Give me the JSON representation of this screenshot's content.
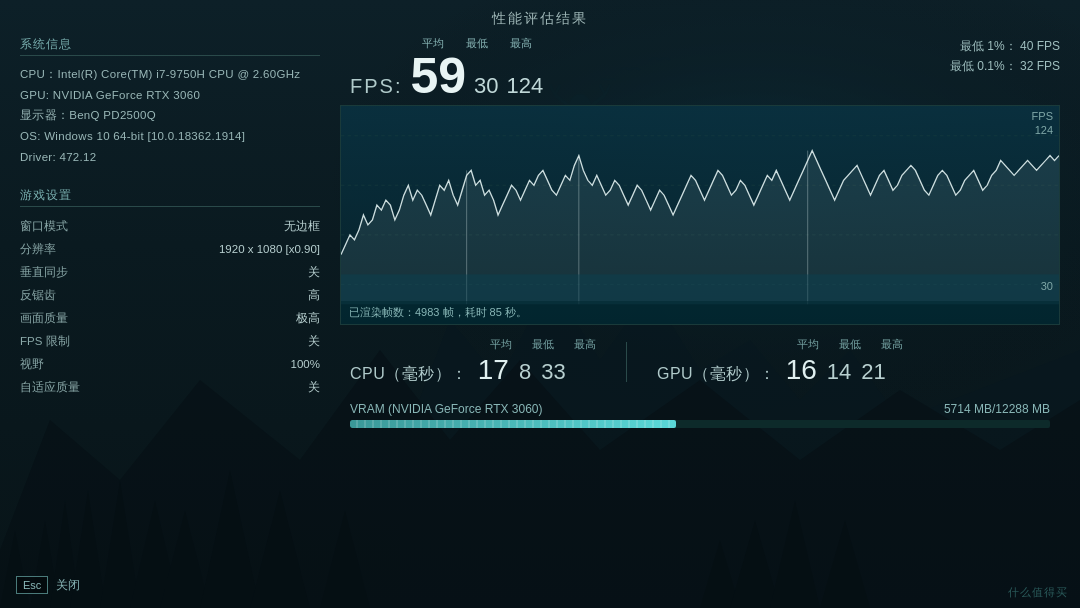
{
  "title": "性能评估结果",
  "left": {
    "system_title": "系统信息",
    "system_info": [
      "CPU：Intel(R) Core(TM) i7-9750H CPU @ 2.60GHz",
      "GPU: NVIDIA GeForce RTX 3060",
      "显示器：BenQ PD2500Q",
      "OS: Windows 10  64-bit [10.0.18362.1914]",
      "Driver: 472.12"
    ],
    "settings_title": "游戏设置",
    "settings": [
      {
        "key": "窗口模式",
        "val": "无边框"
      },
      {
        "key": "分辨率",
        "val": "1920 x 1080 [x0.90]"
      },
      {
        "key": "垂直同步",
        "val": "关"
      },
      {
        "key": "反锯齿",
        "val": "高"
      },
      {
        "key": "画面质量",
        "val": "极高"
      },
      {
        "key": "FPS 限制",
        "val": "关"
      },
      {
        "key": "视野",
        "val": "100%"
      },
      {
        "key": "自适应质量",
        "val": "关"
      }
    ]
  },
  "fps": {
    "label": "FPS:",
    "avg_label": "平均",
    "min_label": "最低",
    "max_label": "最高",
    "avg": "59",
    "min": "30",
    "max": "124",
    "low1_label": "最低 1%：",
    "low1_value": "40 FPS",
    "low01_label": "最低 0.1%：",
    "low01_value": "32 FPS",
    "graph_fps_label": "FPS",
    "graph_max_label": "124",
    "graph_min_label": "30",
    "rendered_info": "已渲染帧数：4983 帧，耗时 85 秒。"
  },
  "cpu": {
    "label": "CPU（毫秒）：",
    "avg_label": "平均",
    "min_label": "最低",
    "max_label": "最高",
    "avg": "17",
    "min": "8",
    "max": "33"
  },
  "gpu": {
    "label": "GPU（毫秒）：",
    "avg_label": "平均",
    "min_label": "最低",
    "max_label": "最高",
    "avg": "16",
    "min": "14",
    "max": "21"
  },
  "vram": {
    "label": "VRAM (NVIDIA GeForce RTX 3060)",
    "value": "5714 MB/12288 MB",
    "percent": 46.5
  },
  "esc": {
    "key": "Esc",
    "label": "关闭"
  },
  "watermark": "什么值得买"
}
